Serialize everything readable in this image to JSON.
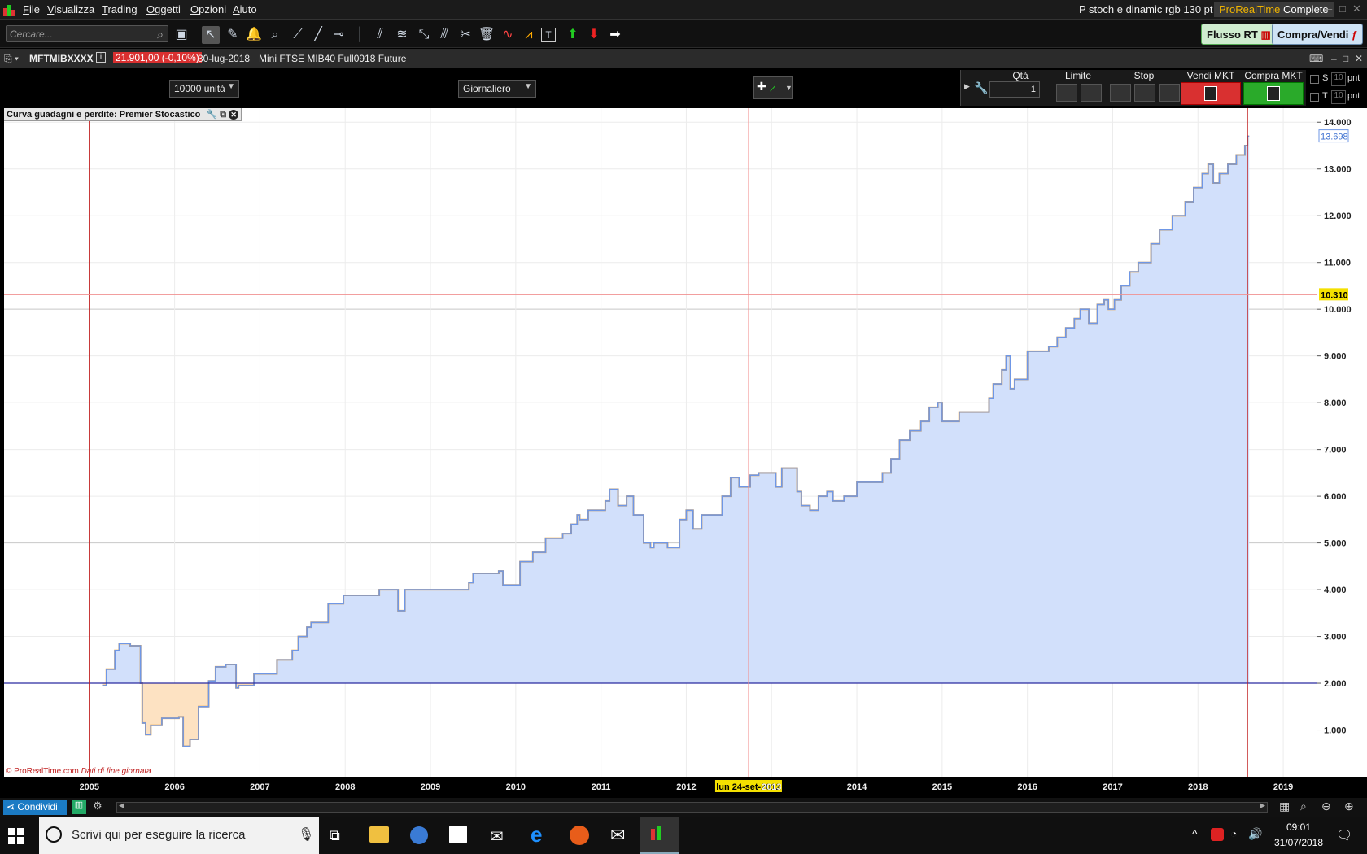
{
  "menubar": {
    "items": [
      "File",
      "Visualizza",
      "Trading",
      "Oggetti",
      "Opzioni",
      "Aiuto"
    ],
    "window_title": "P stoch e dinamic rgb 130 pt",
    "brand_a": "ProRealTime",
    "brand_b": "Complete"
  },
  "toolbar": {
    "search_placeholder": "Cercare...",
    "flusso_label": "Flusso RT",
    "compra_vendi_label": "Compra/Vendi"
  },
  "instrument": {
    "symbol": "MFTMIBXXXX",
    "price_change": "21.901,00 (-0,10%)",
    "date": "30-lug-2018",
    "name": "Mini FTSE MIB40 Full0918 Future"
  },
  "settings": {
    "units": "10000 unità",
    "period": "Giornaliero"
  },
  "order_panel": {
    "qty_label": "Qtà",
    "qty_value": "1",
    "limit_label": "Limite",
    "stop_label": "Stop",
    "sell_label": "Vendi MKT",
    "buy_label": "Compra MKT",
    "s_label": "S",
    "t_label": "T",
    "s_value": "10",
    "t_value": "10",
    "unit": "pnt"
  },
  "chart": {
    "panel_title": "Curva guadagni e perdite: Premier Stocastico",
    "copyright": "© ProRealTime.com",
    "copyright_note": "Dati di fine giornata",
    "cursor_date": "lun 24-set-2012",
    "cursor_value": "10.310",
    "last_value": "13.698",
    "colors": {
      "line": "#6f97e6",
      "fill": "#d2e0fb",
      "loss_line": "#f0a030",
      "loss_fill": "#fde2c2"
    }
  },
  "chart_data": {
    "type": "area",
    "title": "Curva guadagni e perdite: Premier Stocastico",
    "xlabel": "",
    "ylabel": "",
    "x_ticks": [
      "2005",
      "2006",
      "2007",
      "2008",
      "2009",
      "2010",
      "2011",
      "2012",
      "2013",
      "2014",
      "2015",
      "2016",
      "2017",
      "2018",
      "2019"
    ],
    "y_ticks": [
      "1.000",
      "2.000",
      "3.000",
      "4.000",
      "5.000",
      "6.000",
      "7.000",
      "8.000",
      "9.000",
      "10.000",
      "11.000",
      "12.000",
      "13.000",
      "14.000"
    ],
    "ylim": [
      0,
      14300
    ],
    "xlim": [
      2004.0,
      2019.4
    ],
    "baseline": 2000,
    "series": [
      {
        "x": [
          2005.15,
          2005.2,
          2005.3,
          2005.35,
          2005.48,
          2005.6,
          2005.62,
          2005.66,
          2005.72,
          2005.85,
          2006.05,
          2006.1,
          2006.18,
          2006.28,
          2006.4,
          2006.48,
          2006.6,
          2006.72,
          2006.75,
          2006.9,
          2006.93,
          2007.1,
          2007.2,
          2007.38,
          2007.45,
          2007.55,
          2007.6,
          2007.8,
          2007.98,
          2008.2,
          2008.4,
          2008.58,
          2008.62,
          2008.7,
          2009.1,
          2009.45,
          2009.5,
          2009.8,
          2009.85,
          2010.05,
          2010.2,
          2010.35,
          2010.55,
          2010.65,
          2010.72,
          2010.75,
          2010.85,
          2011.05,
          2011.1,
          2011.2,
          2011.3,
          2011.38,
          2011.5,
          2011.58,
          2011.62,
          2011.78,
          2011.92,
          2012.0,
          2012.08,
          2012.18,
          2012.3,
          2012.42,
          2012.52,
          2012.62,
          2012.75,
          2012.85,
          2013.05,
          2013.12,
          2013.3,
          2013.35,
          2013.45,
          2013.55,
          2013.65,
          2013.72,
          2013.85,
          2014.0,
          2014.3,
          2014.4,
          2014.5,
          2014.62,
          2014.75,
          2014.85,
          2014.95,
          2015.0,
          2015.2,
          2015.4,
          2015.55,
          2015.6,
          2015.7,
          2015.75,
          2015.8,
          2015.85,
          2016.0,
          2016.25,
          2016.35,
          2016.45,
          2016.55,
          2016.62,
          2016.72,
          2016.82,
          2016.9,
          2016.95,
          2017.02,
          2017.1,
          2017.2,
          2017.3,
          2017.45,
          2017.55,
          2017.7,
          2017.85,
          2017.95,
          2018.05,
          2018.12,
          2018.18,
          2018.25,
          2018.35,
          2018.45,
          2018.55,
          2018.58
        ],
        "values": [
          1950,
          2300,
          2700,
          2850,
          2800,
          2000,
          1150,
          900,
          1100,
          1250,
          1280,
          650,
          800,
          1500,
          2050,
          2350,
          2400,
          1900,
          1950,
          1950,
          2200,
          2200,
          2500,
          2700,
          3000,
          3200,
          3300,
          3700,
          3880,
          3880,
          4000,
          4000,
          3550,
          4000,
          4000,
          4150,
          4350,
          4400,
          4100,
          4600,
          4800,
          5100,
          5200,
          5400,
          5600,
          5500,
          5700,
          5900,
          6150,
          5800,
          6000,
          5600,
          5000,
          4900,
          5000,
          4900,
          5500,
          5700,
          5300,
          5600,
          5600,
          6000,
          6400,
          6200,
          6450,
          6500,
          6200,
          6600,
          6100,
          5800,
          5700,
          6000,
          6100,
          5900,
          6000,
          6300,
          6500,
          6800,
          7200,
          7400,
          7600,
          7900,
          8000,
          7600,
          7800,
          7800,
          8100,
          8400,
          8700,
          9000,
          8300,
          8500,
          9100,
          9200,
          9400,
          9600,
          9800,
          10000,
          9700,
          10100,
          10200,
          10000,
          10200,
          10500,
          10800,
          11000,
          11400,
          11700,
          12000,
          12300,
          12600,
          12900,
          13100,
          12700,
          12900,
          13100,
          13300,
          13500,
          13698
        ]
      }
    ]
  },
  "bottombar": {
    "share_label": "Condividi"
  },
  "taskbar": {
    "search_placeholder": "Scrivi qui per eseguire la ricerca",
    "time": "09:01",
    "date": "31/07/2018"
  }
}
